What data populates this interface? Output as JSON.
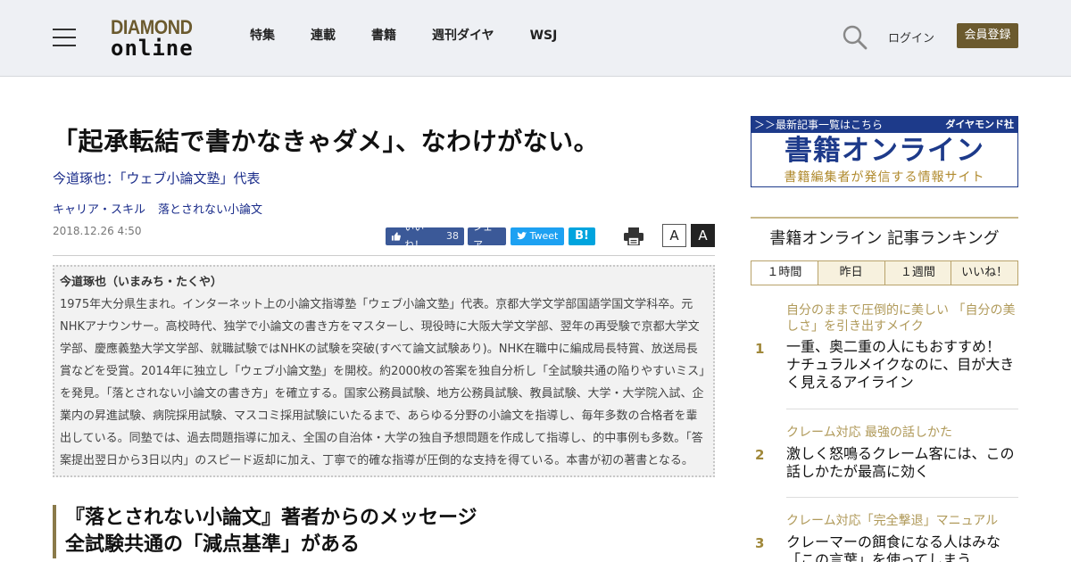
{
  "header": {
    "logo_top": "DIAMOND",
    "logo_bottom": "online",
    "nav": [
      "特集",
      "連載",
      "書籍",
      "週刊ダイヤ",
      "WSJ"
    ],
    "login": "ログイン",
    "register": "会員登録"
  },
  "article": {
    "title": "「起承転結で書かなきゃダメ」、なわけがない。",
    "author": "今道琢也：「ウェブ小論文塾」代表",
    "tags": [
      "キャリア・スキル",
      "落とされない小論文"
    ],
    "date": "2018.12.26 4:50",
    "share": {
      "like_label": "いいね！",
      "like_count": "38",
      "facebook_share": "シェア",
      "tweet": "Tweet",
      "hatena": "B!"
    },
    "font_small": "A",
    "font_large": "A",
    "profile_name": "今道琢也（いまみち・たくや）",
    "profile_body": "1975年大分県生まれ。インターネット上の小論文指導塾「ウェブ小論文塾」代表。京都大学文学部国語学国文学科卒。元NHKアナウンサー。高校時代、独学で小論文の書き方をマスターし、現役時に大阪大学文学部、翌年の再受験で京都大学文学部、慶應義塾大学文学部、就職試験ではNHKの試験を突破(すべて論文試験あり)。NHK在職中に編成局長特賞、放送局長賞などを受賞。2014年に独立し「ウェブ小論文塾」を開校。約2000枚の答案を独自分析し「全試験共通の陥りやすいミス」を発見。「落とされない小論文の書き方」を確立する。国家公務員試験、地方公務員試験、教員試験、大学・大学院入試、企業内の昇進試験、病院採用試験、マスコミ採用試験にいたるまで、あらゆる分野の小論文を指導し、毎年多数の合格者を輩出している。同塾では、過去問題指導に加え、全国の自治体・大学の独自予想問題を作成して指導し、的中事例も多数。「答案提出翌日から3日以内」のスピード返却に加え、丁寧で的確な指導が圧倒的な支持を得ている。本書が初の著書となる。",
    "section_heading_1": "『落とされない小論文』著者からのメッセージ",
    "section_heading_2": "全試験共通の「減点基準」がある"
  },
  "sidebar": {
    "banner_link": "＞＞最新記事一覧はこちら",
    "banner_brand": "ダイヤモンド社",
    "banner_title": "書籍オンライン",
    "banner_sub": "書籍編集者が発信する情報サイト",
    "ranking_title": "書籍オンライン 記事ランキング",
    "tabs": [
      "１時間",
      "昨日",
      "１週間",
      "いいね！"
    ],
    "ranking": [
      {
        "rank": "1",
        "category": "自分のままで圧倒的に美しい 「自分の美しさ」を引き出すメイク",
        "title": "一重、奥二重の人にもおすすめ！ ナチュラルメイクなのに、目が大きく見えるアイライン"
      },
      {
        "rank": "2",
        "category": "クレーム対応 最強の話しかた",
        "title": "激しく怒鳴るクレーム客には、この話しかたが最高に効く"
      },
      {
        "rank": "3",
        "category": "クレーム対応「完全撃退」マニュアル",
        "title": "クレーマーの餌食になる人はみな「この言葉」を使ってしまう"
      }
    ]
  }
}
